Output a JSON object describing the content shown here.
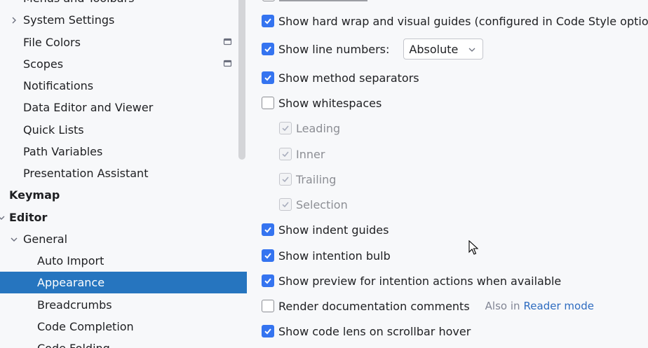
{
  "sidebar": {
    "items": [
      {
        "label": "Menus and Toolbars"
      },
      {
        "label": "System Settings"
      },
      {
        "label": "File Colors"
      },
      {
        "label": "Scopes"
      },
      {
        "label": "Notifications"
      },
      {
        "label": "Data Editor and Viewer"
      },
      {
        "label": "Quick Lists"
      },
      {
        "label": "Path Variables"
      },
      {
        "label": "Presentation Assistant"
      },
      {
        "label": "Keymap"
      },
      {
        "label": "Editor"
      },
      {
        "label": "General"
      },
      {
        "label": "Auto Import"
      },
      {
        "label": "Appearance"
      },
      {
        "label": "Breadcrumbs"
      },
      {
        "label": "Code Completion"
      },
      {
        "label": "Code Folding"
      }
    ],
    "selected": "Appearance"
  },
  "main": {
    "options": {
      "hard_wrap": {
        "label": "Show hard wrap and visual guides (configured in Code Style options)",
        "checked": true
      },
      "line_numbers": {
        "label": "Show line numbers:",
        "checked": true,
        "select_value": "Absolute"
      },
      "method_separators": {
        "label": "Show method separators",
        "checked": true
      },
      "whitespaces": {
        "label": "Show whitespaces",
        "checked": false
      },
      "leading": {
        "label": "Leading",
        "checked": true,
        "enabled": false
      },
      "inner": {
        "label": "Inner",
        "checked": true,
        "enabled": false
      },
      "trailing": {
        "label": "Trailing",
        "checked": true,
        "enabled": false
      },
      "selection": {
        "label": "Selection",
        "checked": true,
        "enabled": false
      },
      "indent_guides": {
        "label": "Show indent guides",
        "checked": true
      },
      "intention_bulb": {
        "label": "Show intention bulb",
        "checked": true
      },
      "intention_preview": {
        "label": "Show preview for intention actions when available",
        "checked": true
      },
      "render_docs": {
        "label": "Render documentation comments",
        "checked": false,
        "hint": "Also in",
        "hint_link": "Reader mode"
      },
      "code_lens": {
        "label": "Show code lens on scrollbar hover",
        "checked": true
      }
    }
  },
  "colors": {
    "accent": "#3574f0",
    "selection": "#2675bf",
    "background": "#f7f8fa",
    "link": "#2e6cc0"
  }
}
